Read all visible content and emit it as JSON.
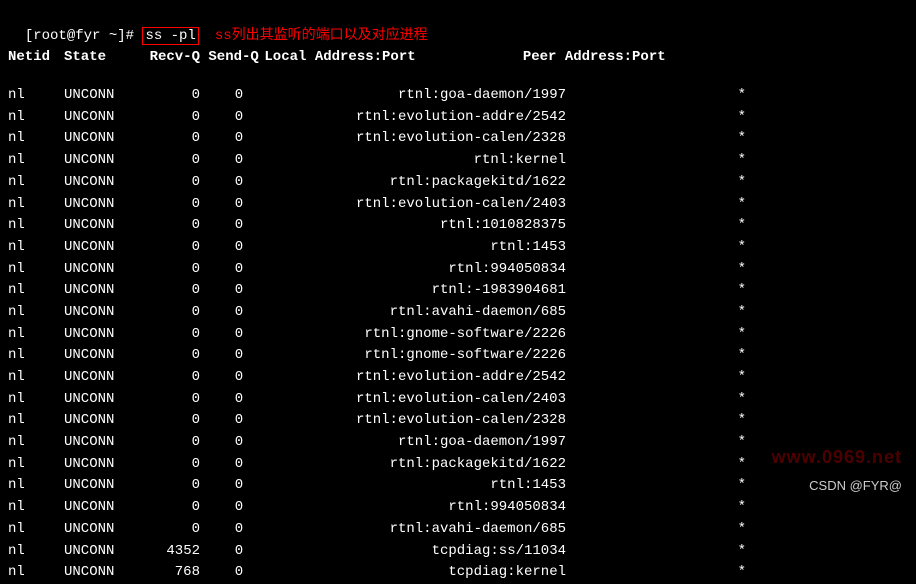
{
  "prompt": "[root@fyr ~]#",
  "command": "ss -pl",
  "annotation": "ss列出其监听的端口以及对应进程",
  "headers": {
    "netid": "Netid",
    "state": "State",
    "recvq": "Recv-Q",
    "sendq": "Send-Q",
    "local": "Local Address:Port",
    "peer": "Peer Address:Port"
  },
  "rows": [
    {
      "netid": "nl",
      "state": "UNCONN",
      "recvq": "0",
      "sendq": "0",
      "local": "rtnl:goa-daemon/1997",
      "peer": "*"
    },
    {
      "netid": "nl",
      "state": "UNCONN",
      "recvq": "0",
      "sendq": "0",
      "local": "rtnl:evolution-addre/2542",
      "peer": "*"
    },
    {
      "netid": "nl",
      "state": "UNCONN",
      "recvq": "0",
      "sendq": "0",
      "local": "rtnl:evolution-calen/2328",
      "peer": "*"
    },
    {
      "netid": "nl",
      "state": "UNCONN",
      "recvq": "0",
      "sendq": "0",
      "local": "rtnl:kernel",
      "peer": "*"
    },
    {
      "netid": "nl",
      "state": "UNCONN",
      "recvq": "0",
      "sendq": "0",
      "local": "rtnl:packagekitd/1622",
      "peer": "*"
    },
    {
      "netid": "nl",
      "state": "UNCONN",
      "recvq": "0",
      "sendq": "0",
      "local": "rtnl:evolution-calen/2403",
      "peer": "*"
    },
    {
      "netid": "nl",
      "state": "UNCONN",
      "recvq": "0",
      "sendq": "0",
      "local": "rtnl:1010828375",
      "peer": "*"
    },
    {
      "netid": "nl",
      "state": "UNCONN",
      "recvq": "0",
      "sendq": "0",
      "local": "rtnl:1453",
      "peer": "*"
    },
    {
      "netid": "nl",
      "state": "UNCONN",
      "recvq": "0",
      "sendq": "0",
      "local": "rtnl:994050834",
      "peer": "*"
    },
    {
      "netid": "nl",
      "state": "UNCONN",
      "recvq": "0",
      "sendq": "0",
      "local": "rtnl:-1983904681",
      "peer": "*"
    },
    {
      "netid": "nl",
      "state": "UNCONN",
      "recvq": "0",
      "sendq": "0",
      "local": "rtnl:avahi-daemon/685",
      "peer": "*"
    },
    {
      "netid": "nl",
      "state": "UNCONN",
      "recvq": "0",
      "sendq": "0",
      "local": "rtnl:gnome-software/2226",
      "peer": "*"
    },
    {
      "netid": "nl",
      "state": "UNCONN",
      "recvq": "0",
      "sendq": "0",
      "local": "rtnl:gnome-software/2226",
      "peer": "*"
    },
    {
      "netid": "nl",
      "state": "UNCONN",
      "recvq": "0",
      "sendq": "0",
      "local": "rtnl:evolution-addre/2542",
      "peer": "*"
    },
    {
      "netid": "nl",
      "state": "UNCONN",
      "recvq": "0",
      "sendq": "0",
      "local": "rtnl:evolution-calen/2403",
      "peer": "*"
    },
    {
      "netid": "nl",
      "state": "UNCONN",
      "recvq": "0",
      "sendq": "0",
      "local": "rtnl:evolution-calen/2328",
      "peer": "*"
    },
    {
      "netid": "nl",
      "state": "UNCONN",
      "recvq": "0",
      "sendq": "0",
      "local": "rtnl:goa-daemon/1997",
      "peer": "*"
    },
    {
      "netid": "nl",
      "state": "UNCONN",
      "recvq": "0",
      "sendq": "0",
      "local": "rtnl:packagekitd/1622",
      "peer": "*"
    },
    {
      "netid": "nl",
      "state": "UNCONN",
      "recvq": "0",
      "sendq": "0",
      "local": "rtnl:1453",
      "peer": "*"
    },
    {
      "netid": "nl",
      "state": "UNCONN",
      "recvq": "0",
      "sendq": "0",
      "local": "rtnl:994050834",
      "peer": "*"
    },
    {
      "netid": "nl",
      "state": "UNCONN",
      "recvq": "0",
      "sendq": "0",
      "local": "rtnl:avahi-daemon/685",
      "peer": "*"
    },
    {
      "netid": "nl",
      "state": "UNCONN",
      "recvq": "4352",
      "sendq": "0",
      "local": "tcpdiag:ss/11034",
      "peer": "*"
    },
    {
      "netid": "nl",
      "state": "UNCONN",
      "recvq": "768",
      "sendq": "0",
      "local": "tcpdiag:kernel",
      "peer": "*"
    }
  ],
  "watermark": "www.0969.net",
  "footer": "CSDN @FYR@"
}
